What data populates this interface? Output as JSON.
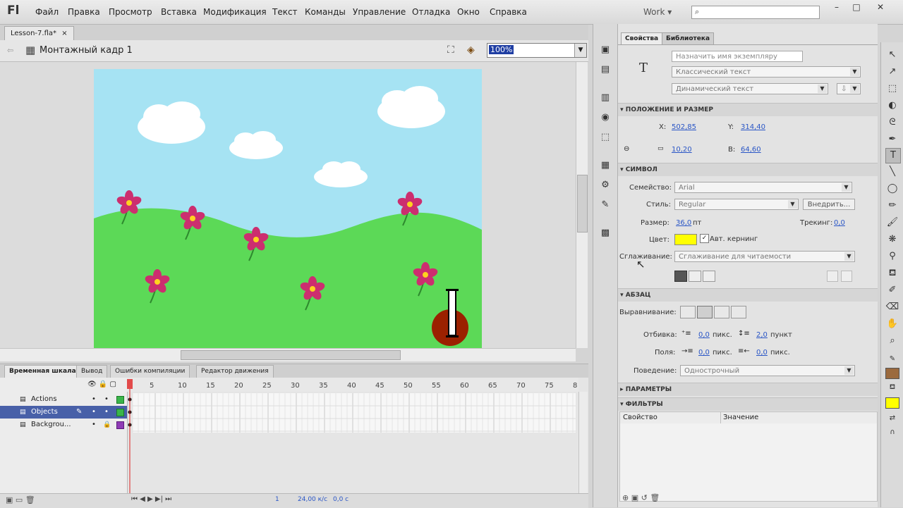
{
  "app": {
    "logo": "Fl",
    "menu": [
      "Файл",
      "Правка",
      "Просмотр",
      "Вставка",
      "Модификация",
      "Текст",
      "Команды",
      "Управление",
      "Отладка",
      "Окно",
      "Справка"
    ],
    "workspace": "Work",
    "window_controls": [
      "–",
      "□",
      "✕"
    ]
  },
  "document": {
    "tab_label": "Lesson-7.fla*",
    "tab_close": "×",
    "scene_label": "Монтажный кадр 1",
    "zoom_value": "100%"
  },
  "timeline": {
    "tabs": [
      "Временная шкала",
      "Вывод",
      "Ошибки компиляции",
      "Редактор движения"
    ],
    "ruler_numbers": [
      "5",
      "10",
      "15",
      "20",
      "25",
      "30",
      "35",
      "40",
      "45",
      "50",
      "55",
      "60",
      "65",
      "70",
      "75",
      "8"
    ],
    "layers": [
      {
        "name": "Actions",
        "color": "#3ab54a"
      },
      {
        "name": "Objects",
        "color": "#3ab54a"
      },
      {
        "name": "Backgrou...",
        "color": "#8e3bb5"
      }
    ],
    "status": {
      "frame": "1",
      "fps": "24,00 к/с",
      "time": "0,0 с"
    }
  },
  "properties": {
    "tabs": [
      "Свойства",
      "Библиотека"
    ],
    "instance_name_placeholder": "Назначить имя экземпляру",
    "text_type": "Классический текст",
    "text_kind": "Динамический текст",
    "sections": {
      "position": "ПОЛОЖЕНИЕ И РАЗМЕР",
      "character": "СИМВОЛ",
      "paragraph": "АБЗАЦ",
      "options": "ПАРАМЕТРЫ",
      "filters": "ФИЛЬТРЫ"
    },
    "x_label": "X:",
    "x_value": "502,85",
    "y_label": "Y:",
    "y_value": "314,40",
    "w_value": "10,20",
    "h_label": "В:",
    "h_value": "64,60",
    "family_label": "Семейство:",
    "family_value": "Arial",
    "style_label": "Стиль:",
    "style_value": "Regular",
    "embed_button": "Внедрить...",
    "size_label": "Размер:",
    "size_value": "36,0",
    "size_unit": "пт",
    "tracking_label": "Трекинг:",
    "tracking_value": "0,0",
    "color_label": "Цвет:",
    "color_value": "#ffff00",
    "autokern_label": "Авт. кернинг",
    "aa_label": "Сглаживание:",
    "aa_value": "Сглаживание для читаемости",
    "align_label": "Выравнивание:",
    "indent_label": "Отбивка:",
    "indent_value": "0,0",
    "px": "пикс.",
    "spacing_value": "2,0",
    "pt": "пункт",
    "margins_label": "Поля:",
    "margin_left": "0,0",
    "margin_right": "0,0",
    "behavior_label": "Поведение:",
    "behavior_value": "Однострочный",
    "filters_col_property": "Свойство",
    "filters_col_value": "Значение"
  },
  "colors": {
    "sky": "#a6e3f3",
    "grass": "#5cd957",
    "flower": "#cc2e6f",
    "ball": "#9b2100",
    "stroke_swatch": "#9b6a3e",
    "fill_swatch": "#ffff00"
  }
}
